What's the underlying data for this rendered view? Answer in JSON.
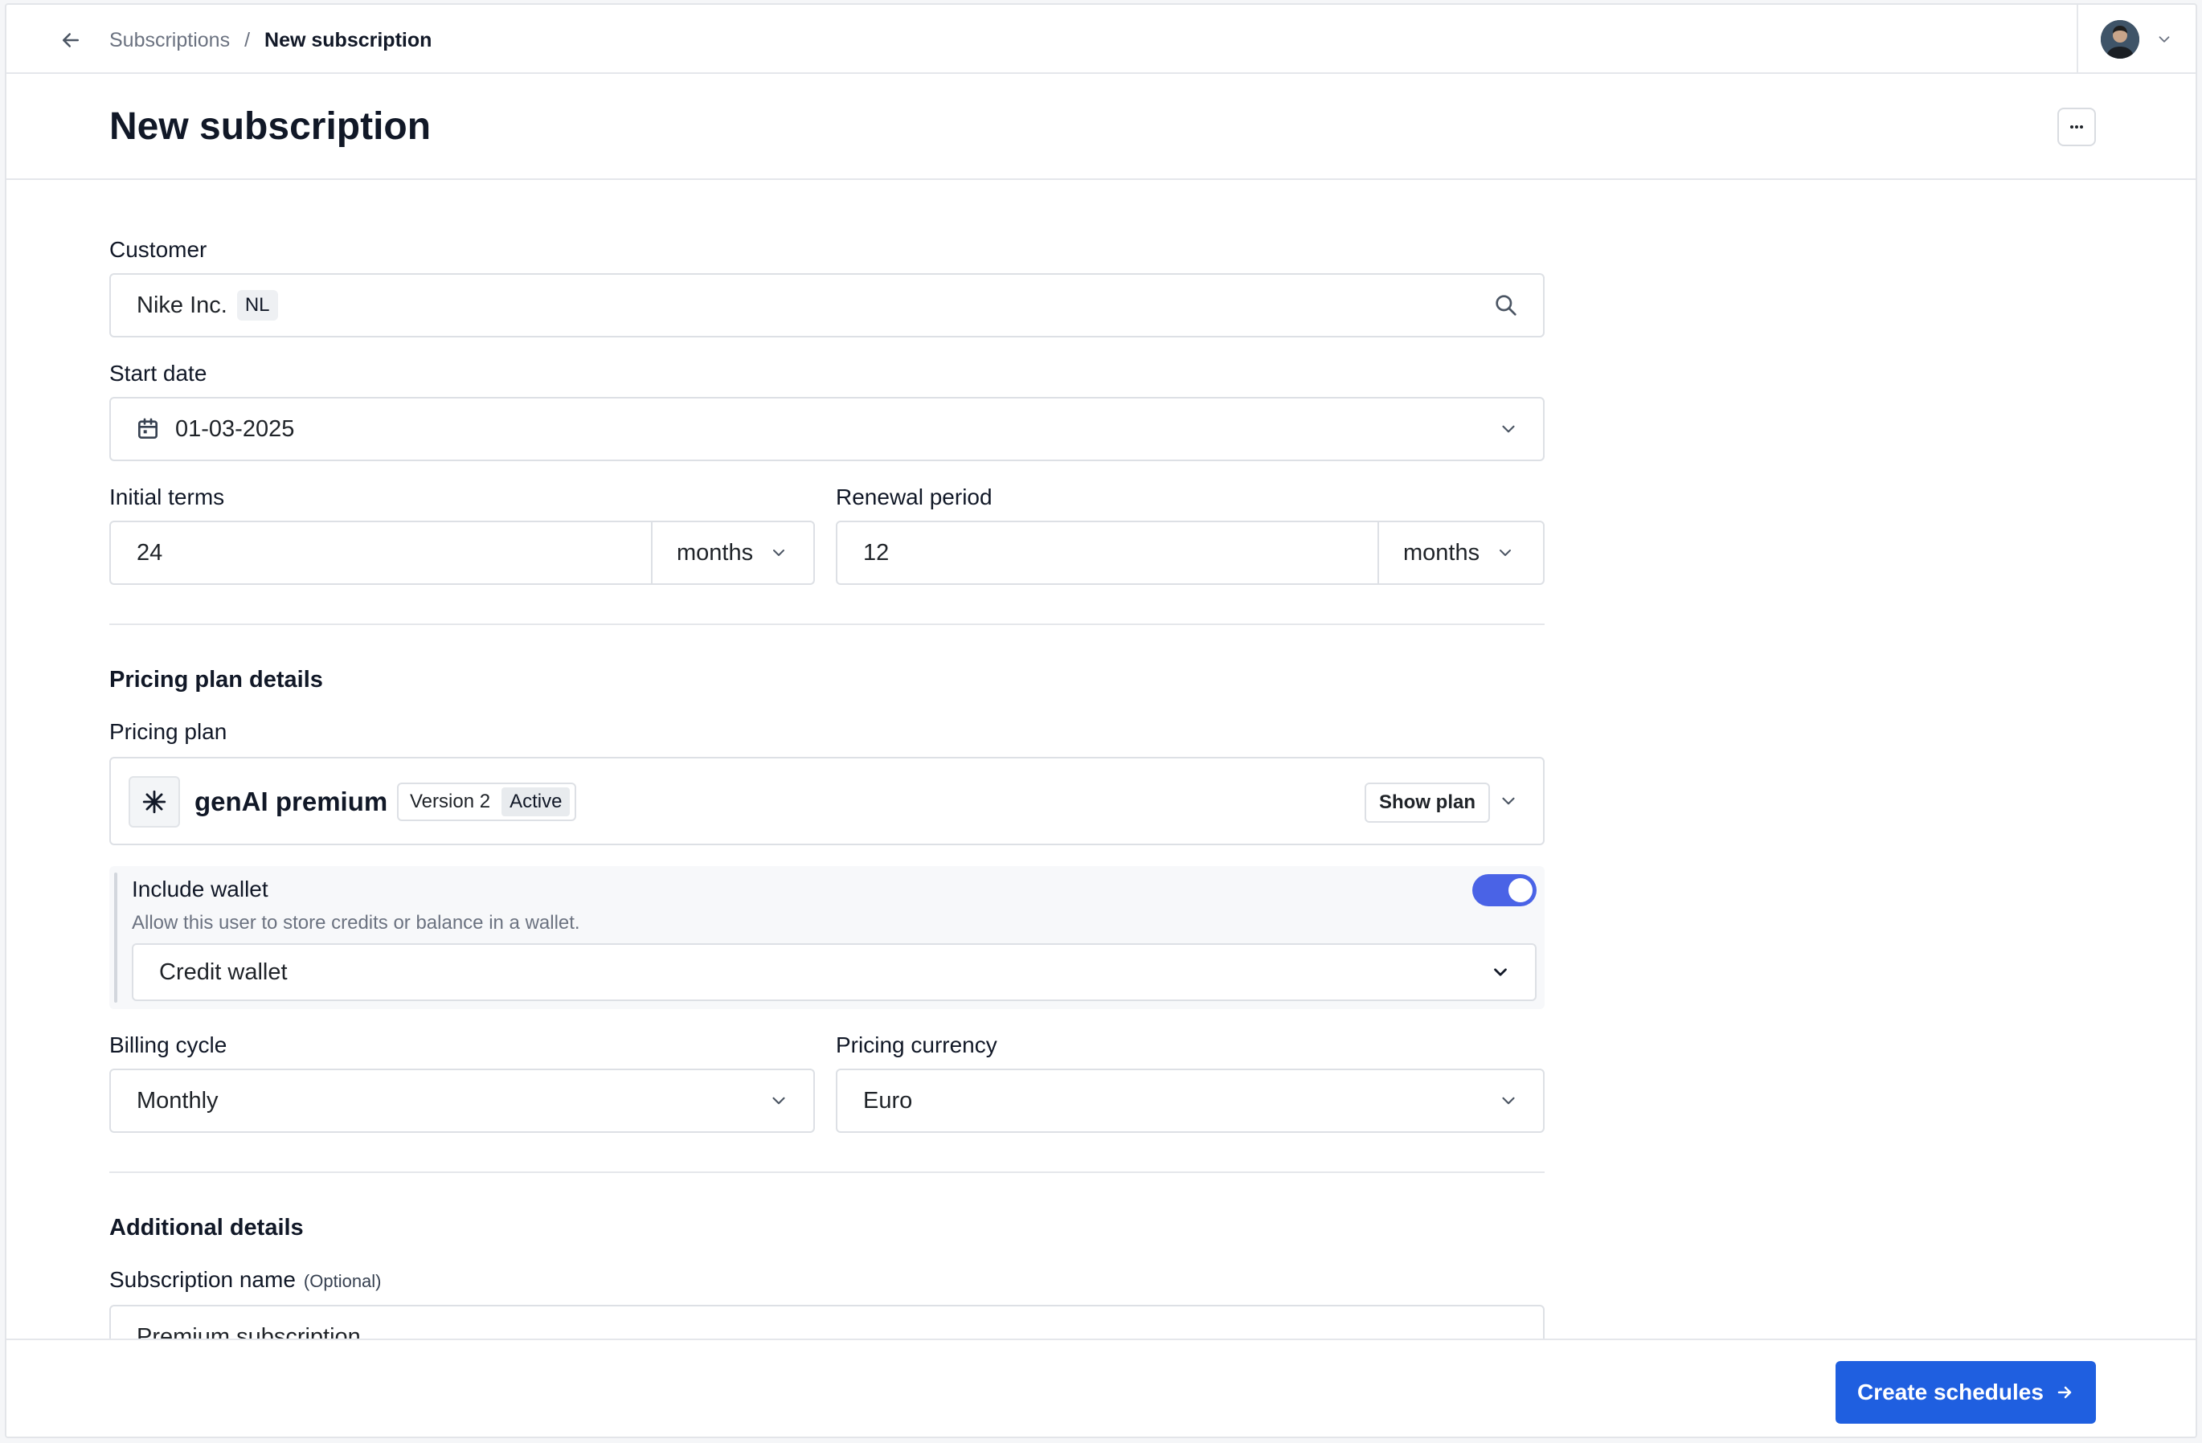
{
  "breadcrumb": {
    "parent": "Subscriptions",
    "separator": "/",
    "current": "New subscription"
  },
  "page": {
    "title": "New subscription"
  },
  "form": {
    "customer": {
      "label": "Customer",
      "name": "Nike Inc.",
      "country": "NL"
    },
    "start_date": {
      "label": "Start date",
      "value": "01-03-2025"
    },
    "initial_terms": {
      "label": "Initial terms",
      "value": "24",
      "unit": "months"
    },
    "renewal_period": {
      "label": "Renewal period",
      "value": "12",
      "unit": "months"
    },
    "pricing_section": {
      "title": "Pricing plan details"
    },
    "pricing_plan": {
      "label": "Pricing plan",
      "name": "genAI premium",
      "version": "Version 2",
      "status": "Active",
      "show_plan": "Show plan"
    },
    "wallet": {
      "title": "Include wallet",
      "description": "Allow this user to store credits or balance in a wallet.",
      "enabled": true,
      "selected": "Credit wallet"
    },
    "billing_cycle": {
      "label": "Billing cycle",
      "value": "Monthly"
    },
    "pricing_currency": {
      "label": "Pricing currency",
      "value": "Euro"
    },
    "additional_section": {
      "title": "Additional details"
    },
    "subscription_name": {
      "label": "Subscription name",
      "optional": "(Optional)",
      "value": "Premium subscription"
    }
  },
  "footer": {
    "create_label": "Create schedules"
  },
  "colors": {
    "primary": "#1f5fe0",
    "toggle_on": "#4a63e6",
    "border": "#dde0e5",
    "muted_text": "#6b7280"
  }
}
